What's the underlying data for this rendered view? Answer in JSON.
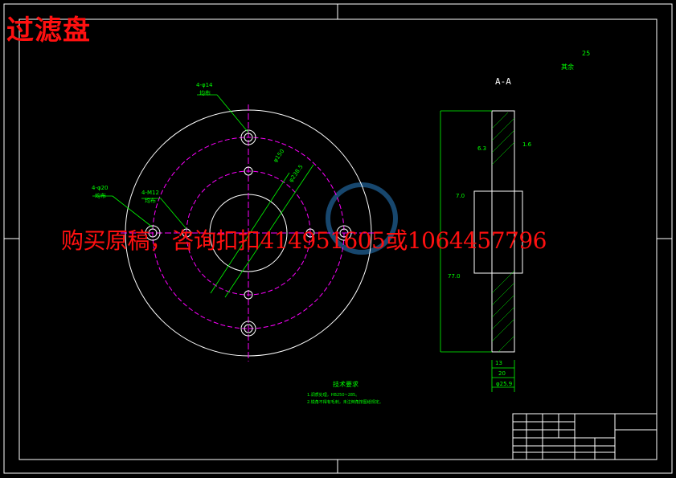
{
  "title": "过滤盘",
  "watermark": "购买原稿，咨询扣扣414951605或1064457796",
  "section_label": "A-A",
  "rough_note": {
    "text": "其余",
    "value": "25"
  },
  "callouts": {
    "holes_top": {
      "size": "4-φ14",
      "note": "均布"
    },
    "holes_left": {
      "size": "4-φ20",
      "note": "均布"
    },
    "thread": {
      "size": "4-M12",
      "note": "均布"
    },
    "dia_150": "φ150",
    "dia_2385": "φ238.5"
  },
  "section_dims": {
    "d1": "13",
    "d2": "20",
    "d3": "φ25.9",
    "r1": "6.3",
    "r2": "1.6",
    "r3": "7.0",
    "r4": "77.0"
  },
  "tech": {
    "title": "技术要求",
    "notes": [
      "1.调质处理，HB250~285。",
      "2.锐角不得有毛刺，未注倒角按图纸规定。"
    ]
  },
  "colors": {
    "line": "#ffffff",
    "dim": "#00ff00",
    "center": "#ff00ff",
    "stamp": "#ff1010",
    "watermark_logo": "#1a4f7a"
  }
}
